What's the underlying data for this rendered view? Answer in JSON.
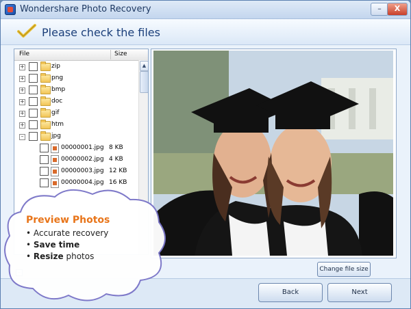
{
  "window": {
    "title": "Wondershare Photo Recovery",
    "minimize_glyph": "–",
    "close_glyph": "X"
  },
  "header": {
    "title": "Please check the files"
  },
  "file_panel": {
    "col_file": "File",
    "col_size": "Size",
    "folders": [
      {
        "name": "zip",
        "expander": "+"
      },
      {
        "name": "png",
        "expander": "+"
      },
      {
        "name": "bmp",
        "expander": "+"
      },
      {
        "name": "doc",
        "expander": "+"
      },
      {
        "name": "gif",
        "expander": "+"
      },
      {
        "name": "htm",
        "expander": "+"
      },
      {
        "name": "jpg",
        "expander": "–"
      }
    ],
    "files": [
      {
        "name": "00000001.jpg",
        "size": "8 KB"
      },
      {
        "name": "00000002.jpg",
        "size": "4 KB"
      },
      {
        "name": "00000003.jpg",
        "size": "12 KB"
      },
      {
        "name": "00000004.jpg",
        "size": "16 KB"
      }
    ]
  },
  "preview": {
    "change_size_label": "Change file size"
  },
  "footer": {
    "back_label": "Back",
    "next_label": "Next",
    "collapse_glyph": "–"
  },
  "callout": {
    "title": "Preview Photos",
    "items": [
      {
        "bullet": "•",
        "bold": "",
        "text": "Accurate recovery"
      },
      {
        "bullet": "•",
        "bold": "Save time",
        "text": ""
      },
      {
        "bullet": "•",
        "bold": "Resize",
        "text": " photos"
      }
    ]
  },
  "colors": {
    "accent_orange": "#e8751a",
    "title_blue": "#1b3f7a",
    "cloud_border": "#7b76c8"
  },
  "icons": {
    "app": "wondershare-app-icon",
    "header": "checkmark-icon",
    "folder": "folder-icon",
    "file": "jpg-file-icon"
  }
}
